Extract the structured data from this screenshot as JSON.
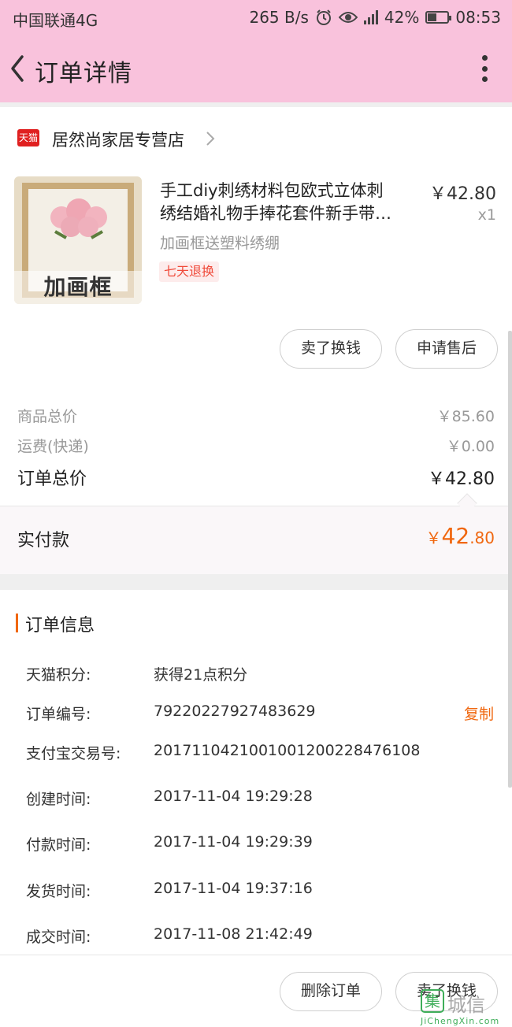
{
  "status_bar": {
    "carrier": "中国联通4G",
    "net_speed": "265 B/s",
    "battery": "42%",
    "time": "08:53"
  },
  "header": {
    "title": "订单详情"
  },
  "store": {
    "badge": "天猫",
    "name": "居然尚家居专营店"
  },
  "product": {
    "name_line1": "手工diy刺绣材料包欧式立体刺",
    "name_line2": "绣结婚礼物手捧花套件新手带…",
    "spec": "加画框送塑料绣绷",
    "tag": "七天退换",
    "price": "￥42.80",
    "qty": "x1",
    "image_caption": "加画框"
  },
  "actions": {
    "sell": "卖了换钱",
    "after_sale": "申请售后"
  },
  "totals": {
    "goods_label": "商品总价",
    "goods_value": "￥85.60",
    "shipping_label": "运费(快递)",
    "shipping_value": "￥0.00",
    "order_label": "订单总价",
    "order_value": "￥42.80",
    "paid_label": "实付款",
    "paid_symbol": "￥",
    "paid_int": "42",
    "paid_dec": ".80"
  },
  "order_info": {
    "title": "订单信息",
    "points_label": "天猫积分:",
    "points_value": "获得21点积分",
    "order_no_label": "订单编号:",
    "order_no_value": "79220227927483629",
    "copy": "复制",
    "alipay_label": "支付宝交易号:",
    "alipay_value": "2017110421001001200228476108",
    "created_label": "创建时间:",
    "created_value": "2017-11-04 19:29:28",
    "paid_label": "付款时间:",
    "paid_value": "2017-11-04 19:29:39",
    "shipped_label": "发货时间:",
    "shipped_value": "2017-11-04 19:37:16",
    "completed_label": "成交时间:",
    "completed_value": "2017-11-08 21:42:49"
  },
  "bottom_actions": {
    "delete": "删除订单",
    "sell": "卖了换钱"
  },
  "watermark": {
    "glyph": "集",
    "cn": "城信",
    "en": "JiChengXin.com"
  },
  "colors": {
    "header_bg": "#f9c2dc",
    "accent": "#f0670f",
    "tmall_red": "#e02020"
  }
}
